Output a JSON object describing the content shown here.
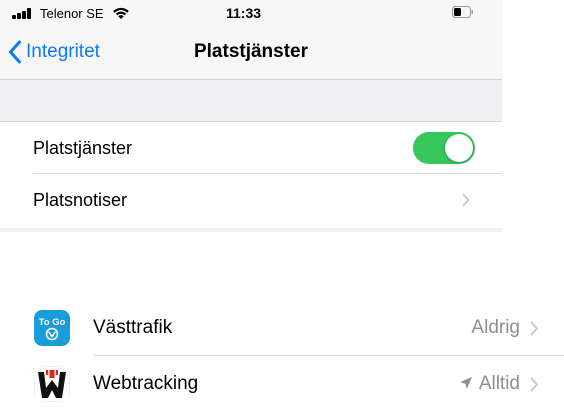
{
  "status_bar": {
    "carrier": "Telenor SE",
    "time": "11:33"
  },
  "nav": {
    "back_label": "Integritet",
    "title": "Platstjänster"
  },
  "settings": {
    "rows": [
      {
        "label": "Platstjänster",
        "toggle_on": true
      },
      {
        "label": "Platsnotiser"
      }
    ]
  },
  "apps": [
    {
      "name": "Västtrafik",
      "status": "Aldrig",
      "icon_text": "To Go"
    },
    {
      "name": "Webtracking",
      "status": "Alltid",
      "location_icon": "location-arrow-icon"
    }
  ],
  "colors": {
    "accent": "#0a7aff",
    "toggle_on": "#35c759",
    "secondary_text": "#8e8e93",
    "group_background": "#efeff4"
  }
}
